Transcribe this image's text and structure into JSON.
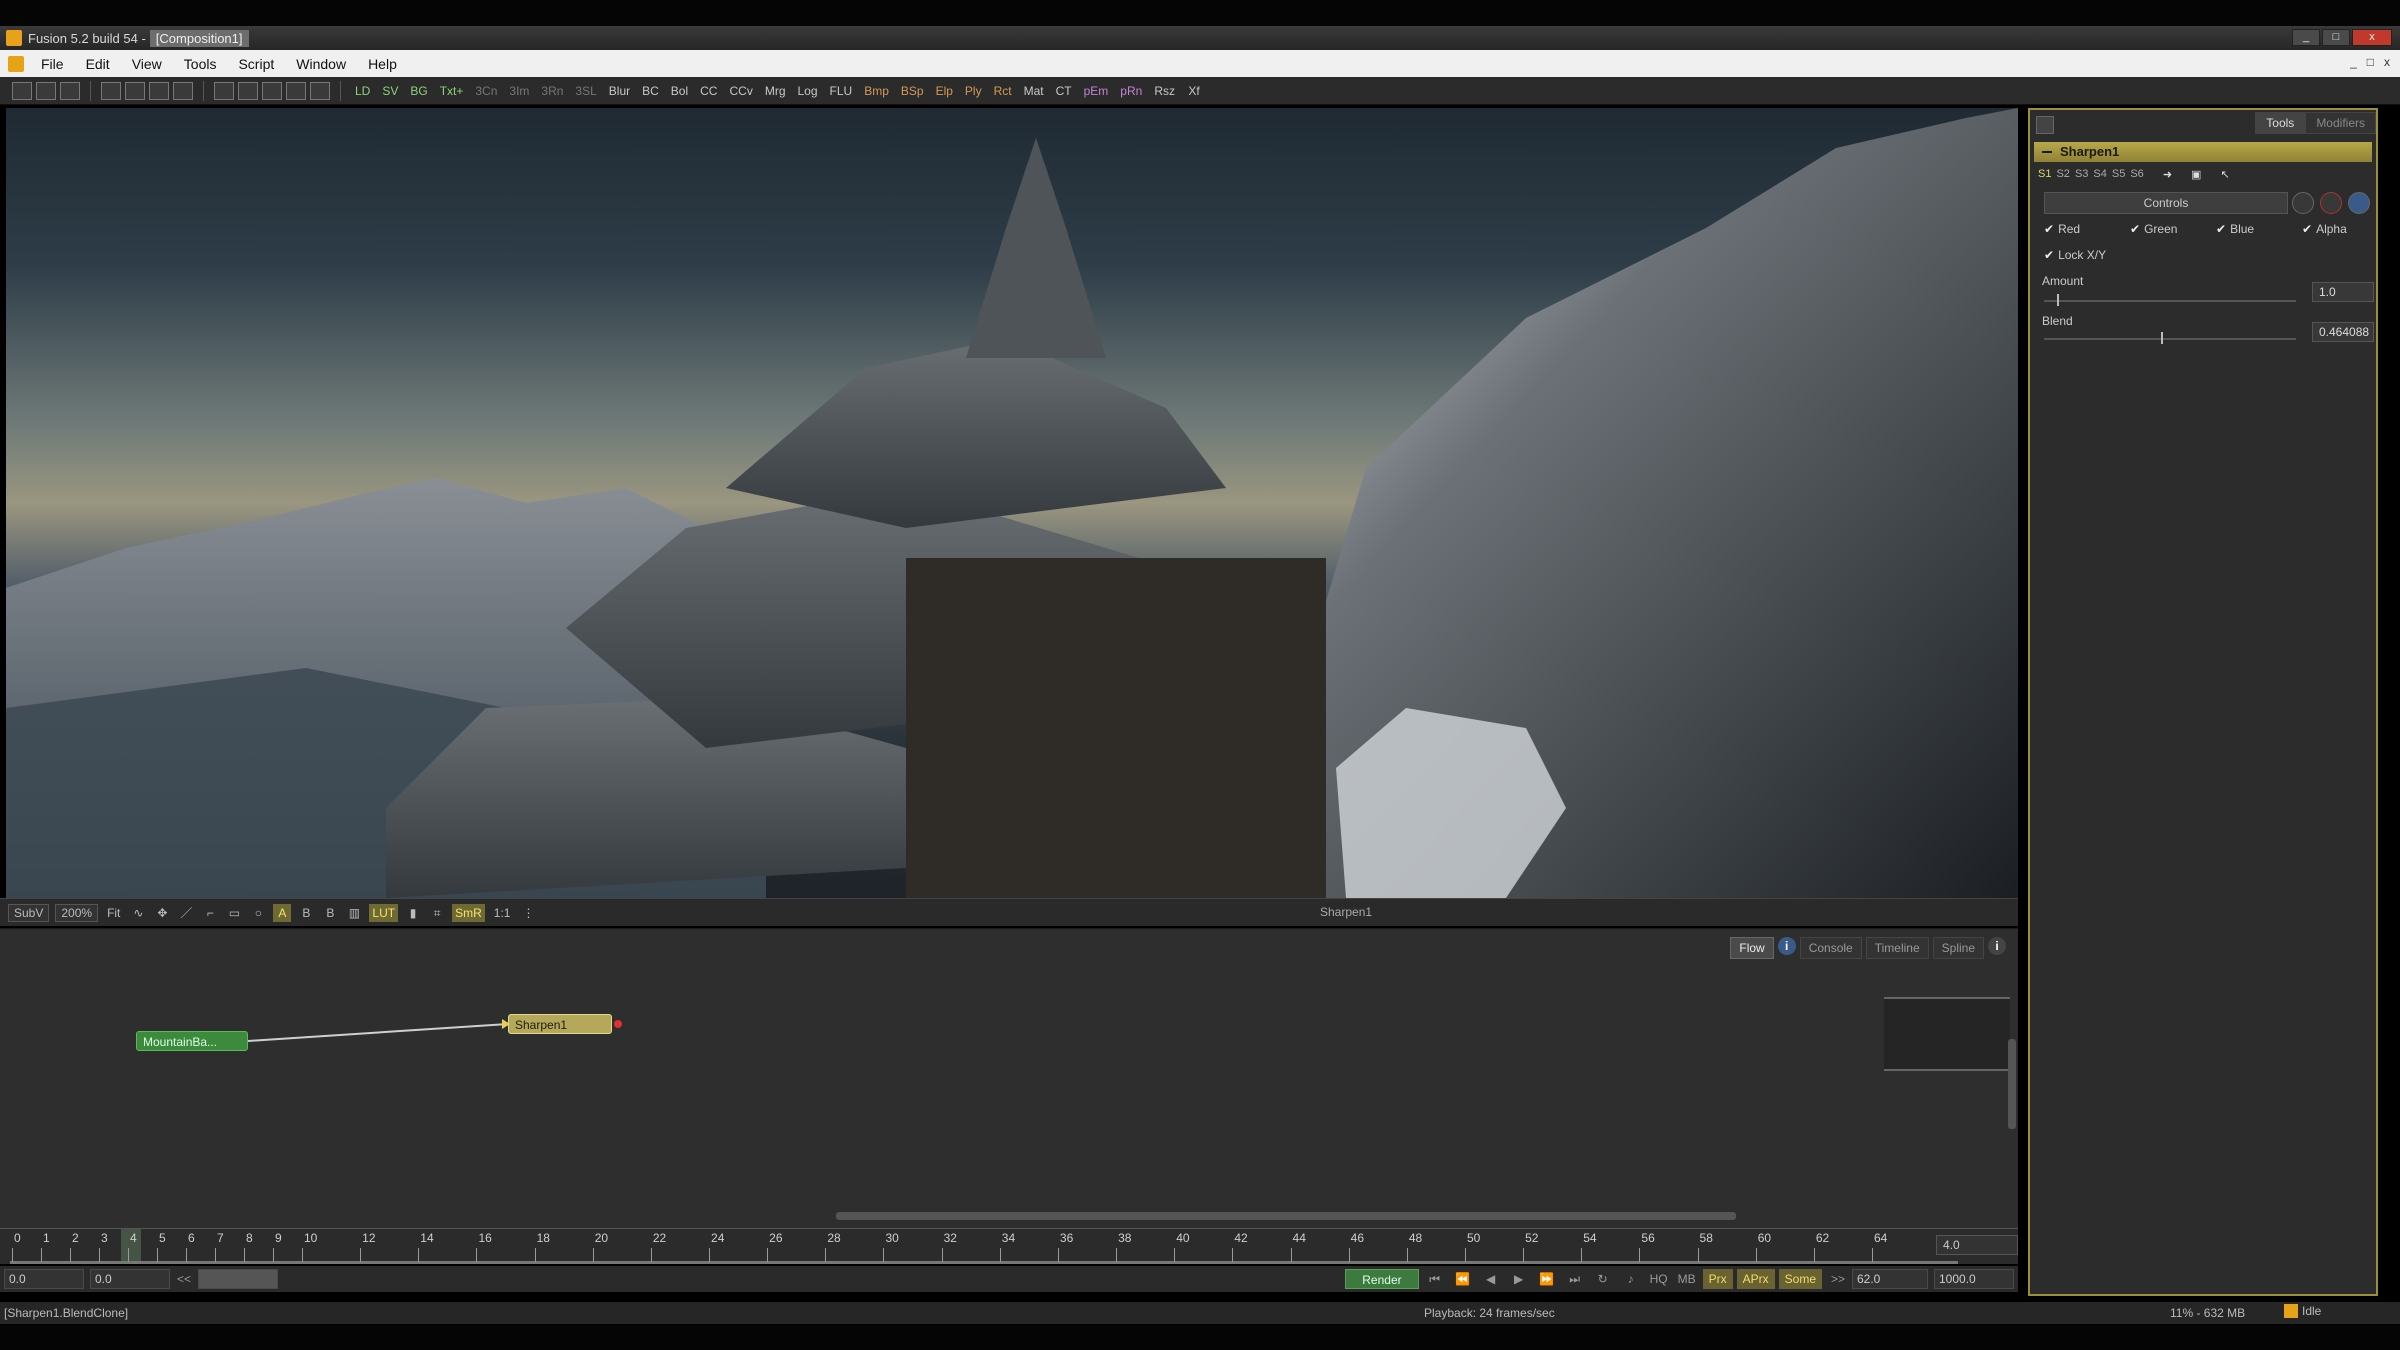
{
  "window": {
    "title": "Fusion 5.2 build 54 -",
    "comp_label": "[Composition1]",
    "controls": [
      "_",
      "□",
      "x"
    ]
  },
  "menu": {
    "items": [
      "File",
      "Edit",
      "View",
      "Tools",
      "Script",
      "Window",
      "Help"
    ],
    "mdi": [
      "_",
      "□",
      "x"
    ]
  },
  "toolbar": {
    "tools": [
      {
        "label": "LD",
        "tone": "green"
      },
      {
        "label": "SV",
        "tone": "green"
      },
      {
        "label": "BG",
        "tone": "green"
      },
      {
        "label": "Txt+",
        "tone": "green"
      },
      {
        "label": "3Cn",
        "tone": "dim"
      },
      {
        "label": "3Im",
        "tone": "dim"
      },
      {
        "label": "3Rn",
        "tone": "dim"
      },
      {
        "label": "3SL",
        "tone": "dim"
      },
      {
        "label": "Blur",
        "tone": ""
      },
      {
        "label": "BC",
        "tone": ""
      },
      {
        "label": "Bol",
        "tone": ""
      },
      {
        "label": "CC",
        "tone": ""
      },
      {
        "label": "CCv",
        "tone": ""
      },
      {
        "label": "Mrg",
        "tone": ""
      },
      {
        "label": "Log",
        "tone": ""
      },
      {
        "label": "FLU",
        "tone": ""
      },
      {
        "label": "Bmp",
        "tone": "orange"
      },
      {
        "label": "BSp",
        "tone": "orange"
      },
      {
        "label": "Elp",
        "tone": "orange"
      },
      {
        "label": "Ply",
        "tone": "orange"
      },
      {
        "label": "Rct",
        "tone": "orange"
      },
      {
        "label": "Mat",
        "tone": ""
      },
      {
        "label": "CT",
        "tone": ""
      },
      {
        "label": "pEm",
        "tone": "purple"
      },
      {
        "label": "pRn",
        "tone": "purple"
      },
      {
        "label": "Rsz",
        "tone": ""
      },
      {
        "label": "Xf",
        "tone": ""
      }
    ]
  },
  "viewer": {
    "subv": "SubV",
    "zoom": "200%",
    "fit": "Fit",
    "buttons": [
      "A",
      "B",
      "B"
    ],
    "lut": "LUT",
    "smr": "SmR",
    "ratio": "1:1",
    "node_label": "Sharpen1"
  },
  "flow": {
    "tabs": [
      "Flow",
      "Console",
      "Timeline",
      "Spline"
    ],
    "active_tab": "Flow",
    "nodes": {
      "loader": "MountainBa...",
      "sharpen": "Sharpen1"
    }
  },
  "timeline": {
    "ticks": [
      "0",
      "1",
      "2",
      "3",
      "4",
      "5",
      "6",
      "7",
      "8",
      "9",
      "10",
      "12",
      "14",
      "16",
      "18",
      "20",
      "22",
      "24",
      "26",
      "28",
      "30",
      "32",
      "34",
      "36",
      "38",
      "40",
      "42",
      "44",
      "46",
      "48",
      "50",
      "52",
      "54",
      "56",
      "58",
      "60",
      "62",
      "64"
    ],
    "end_value": "4.0"
  },
  "transport": {
    "start": "0.0",
    "render_start": "0.0",
    "back": "<<",
    "render_label": "Render",
    "hq": "HQ",
    "mb": "MB",
    "prx": "Prx",
    "aprx": "APrx",
    "some": "Some",
    "fwd": ">>",
    "render_end": "62.0",
    "end": "1000.0"
  },
  "status": {
    "left": "[Sharpen1.BlendClone]",
    "center": "Playback: 24 frames/sec",
    "memory": "11% - 632 MB",
    "state": "Idle"
  },
  "panel": {
    "tabs": [
      "Tools",
      "Modifiers"
    ],
    "active_tab": "Tools",
    "tool_name": "Sharpen1",
    "versions": [
      "S1",
      "S2",
      "S3",
      "S4",
      "S5",
      "S6"
    ],
    "controls_tab": "Controls",
    "checks": [
      "Red",
      "Green",
      "Blue",
      "Alpha"
    ],
    "lock": "Lock X/Y",
    "amount_label": "Amount",
    "amount_value": "1.0",
    "amount_fraction": 0.05,
    "blend_label": "Blend",
    "blend_value": "0.464088",
    "blend_fraction": 0.464
  },
  "colors": {
    "accent_gold": "#9b8f3c",
    "node_loader": "#3c8a3c",
    "node_sharpen": "#b5a85a"
  }
}
